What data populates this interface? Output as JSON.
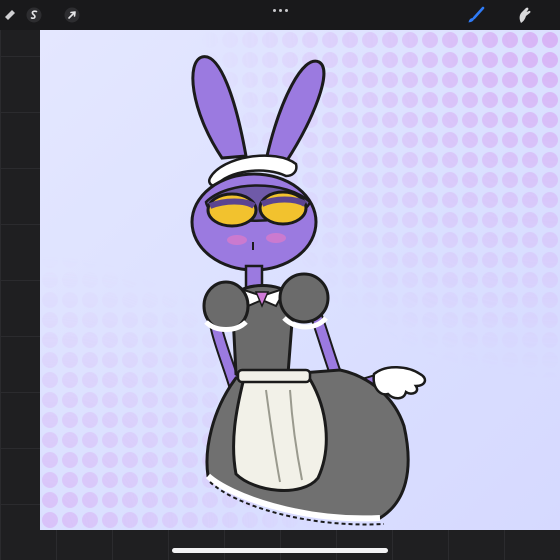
{
  "app": {
    "toolbar": {
      "left_tools": [
        {
          "icon": "wrench-icon"
        },
        {
          "icon": "adjustments-s-icon"
        },
        {
          "icon": "selection-arrow-icon"
        }
      ],
      "center_menu": {
        "icon": "more-dots-icon"
      },
      "right_tools": [
        {
          "icon": "brush-icon",
          "active": true,
          "color": "#2f7bf6"
        },
        {
          "icon": "smudge-icon",
          "active": false,
          "color": "#d9d9db"
        }
      ]
    },
    "canvas": {
      "background_color": "#dde1ff",
      "halftone_color": "#d7a6f2",
      "artwork": "maid-bunny-character"
    },
    "colors": {
      "toolbar_bg": "#19191b",
      "workspace_bg": "#1f1f21",
      "accent": "#2f7bf6"
    }
  }
}
